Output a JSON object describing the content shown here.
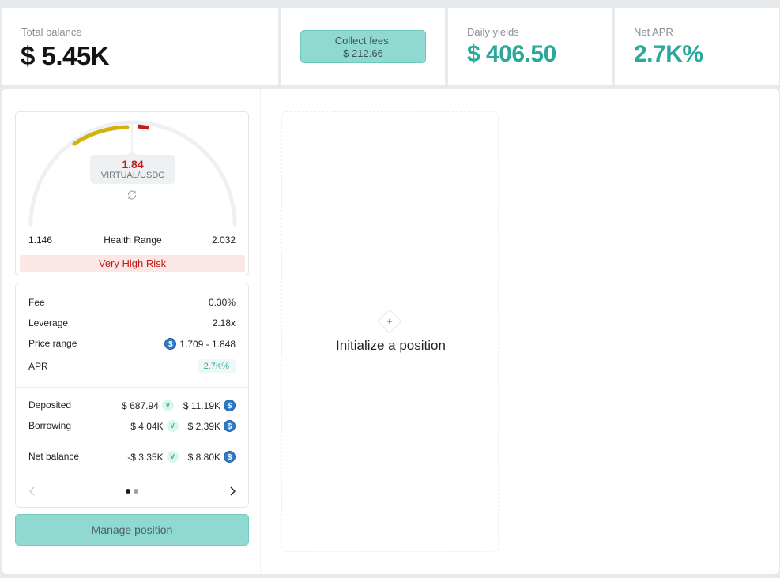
{
  "stats": {
    "total_balance_label": "Total balance",
    "total_balance_value": "$ 5.45K",
    "collect_fees_label": "Collect fees:",
    "collect_fees_value": "$ 212.66",
    "daily_yields_label": "Daily yields",
    "daily_yields_value": "$ 406.50",
    "net_apr_label": "Net APR",
    "net_apr_value": "2.7K%"
  },
  "gauge": {
    "price": "1.84",
    "pair": "VIRTUAL/USDC",
    "range_low": "1.146",
    "range_label": "Health Range",
    "range_high": "2.032",
    "risk_label": "Very High Risk"
  },
  "details": {
    "fee_label": "Fee",
    "fee_value": "0.30%",
    "leverage_label": "Leverage",
    "leverage_value": "2.18x",
    "price_range_label": "Price range",
    "price_range_value": "1.709 - 1.848",
    "apr_label": "APR",
    "apr_value": "2.7K%"
  },
  "balances": {
    "deposited_label": "Deposited",
    "deposited_a": "$ 687.94",
    "deposited_b": "$ 11.19K",
    "borrowing_label": "Borrowing",
    "borrowing_a": "$ 4.04K",
    "borrowing_b": "$ 2.39K",
    "net_label": "Net balance",
    "net_a": "-$ 3.35K",
    "net_b": "$ 8.80K"
  },
  "manage_label": "Manage position",
  "init": {
    "plus": "+",
    "label": "Initialize a position"
  },
  "colors": {
    "accent": "#2aa89a",
    "danger": "#c41a1a",
    "button": "#8fd9d1",
    "risk_bg": "#fbe7e6",
    "gauge_yellow": "#d4b10f"
  },
  "icons": {
    "usdc": "$",
    "virtual": "V"
  }
}
